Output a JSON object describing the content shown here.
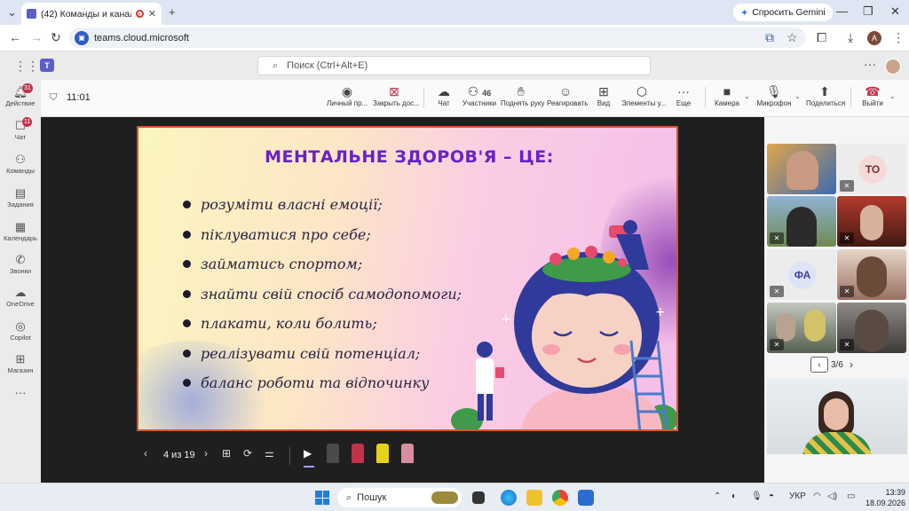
{
  "browser": {
    "tab_title": "(42) Команды и каналы | Те",
    "gemini_label": "Спросить Gemini",
    "url": "teams.cloud.microsoft",
    "profile_initial": "A"
  },
  "teams": {
    "search_placeholder": "Поиск (Ctrl+Alt+E)"
  },
  "rail": [
    {
      "label": "Действие",
      "icon": "bell-icon",
      "badge": "31"
    },
    {
      "label": "Чат",
      "icon": "chat-icon",
      "badge": "11"
    },
    {
      "label": "Команды",
      "icon": "teams-icon"
    },
    {
      "label": "Задания",
      "icon": "assignments-icon"
    },
    {
      "label": "Календарь",
      "icon": "calendar-icon"
    },
    {
      "label": "Звонки",
      "icon": "phone-icon"
    },
    {
      "label": "OneDrive",
      "icon": "cloud-icon"
    },
    {
      "label": "Copilot",
      "icon": "copilot-icon"
    },
    {
      "label": "Магазин",
      "icon": "store-icon"
    }
  ],
  "meeting": {
    "timer": "11:01",
    "buttons": {
      "private": "Личный пр...",
      "stop_sharing": "Закрыть дос...",
      "chat": "Чат",
      "participants": "Участники",
      "participants_count": "46",
      "raise_hand": "Поднять руку",
      "react": "Реагировать",
      "view": "Вид",
      "apps": "Элементы у...",
      "more": "Еще",
      "camera": "Камера",
      "mic": "Микрофон",
      "share": "Поделиться",
      "leave": "Выйти"
    }
  },
  "slide": {
    "title": "МЕНТАЛЬНЕ ЗДОРОВ'Я – ЦЕ:",
    "bullets": [
      "розуміти власні емоції;",
      "піклуватися про себе;",
      "займатись спортом;",
      "знайти свій спосіб самодопомоги;",
      "плакати, коли болить;",
      "реалізувати свій потенціал;",
      "баланс роботи та відпочинку"
    ]
  },
  "presenter": {
    "page_text": "4 из 19"
  },
  "gallery": {
    "tile_initials_1": "ТО",
    "tile_initials_2": "ФА",
    "page": "3/6"
  },
  "taskbar": {
    "search_label": "Пошук",
    "lang": "УКР",
    "time": "13:39",
    "date": "18.09.2026"
  }
}
